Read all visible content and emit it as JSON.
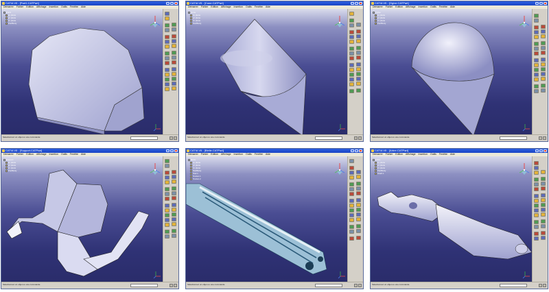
{
  "menus": [
    "Démarrer",
    "Fichier",
    "Edition",
    "Affichage",
    "Insertion",
    "Outils",
    "Fenêtre",
    "Aide"
  ],
  "windows": [
    {
      "title": "CATIA V5 - [Part1.CATPart]",
      "tree": [
        "Part1",
        "xy plane",
        "yz plane",
        "zx plane",
        "PartBody"
      ],
      "status": "Sélectionnez un objet ou une commande",
      "part": "freeform-block"
    },
    {
      "title": "CATIA V5 - [Cone.CATPart]",
      "tree": [
        "Cone",
        "xy plane",
        "yz plane",
        "zx plane",
        "PartBody"
      ],
      "status": "Sélectionnez un objet ou une commande",
      "part": "cone"
    },
    {
      "title": "CATIA V5 - [Ogive.CATPart]",
      "tree": [
        "Ogive",
        "xy plane",
        "yz plane",
        "zx plane",
        "PartBody"
      ],
      "status": "Sélectionnez un objet ou une commande",
      "part": "ogive"
    },
    {
      "title": "CATIA V5 - [Support.CATPart]",
      "tree": [
        "Support",
        "xy plane",
        "yz plane",
        "zx plane",
        "PartBody"
      ],
      "status": "Sélectionnez un objet ou une commande",
      "part": "bracket"
    },
    {
      "title": "CATIA V5 - [Bielle.CATPart]",
      "tree": [
        "Bielle",
        "xy plane",
        "yz plane",
        "zx plane",
        "PartBody",
        "Pad.1",
        "Pocket.1",
        "Pocket.2"
      ],
      "status": "Sélectionnez un objet ou une commande",
      "part": "slotted-link"
    },
    {
      "title": "CATIA V5 - [Arbre.CATPart]",
      "tree": [
        "Arbre",
        "xy plane",
        "yz plane",
        "zx plane",
        "PartBody",
        "Shaft.1"
      ],
      "status": "Sélectionnez un objet ou une commande",
      "part": "shaft"
    }
  ],
  "colors": {
    "viewport_top": "#d9dbec",
    "viewport_bottom": "#2a2c6a",
    "part_face": "#c6c8e6",
    "link_face": "#9cc0d6",
    "titlebar": "#1b45c4"
  }
}
